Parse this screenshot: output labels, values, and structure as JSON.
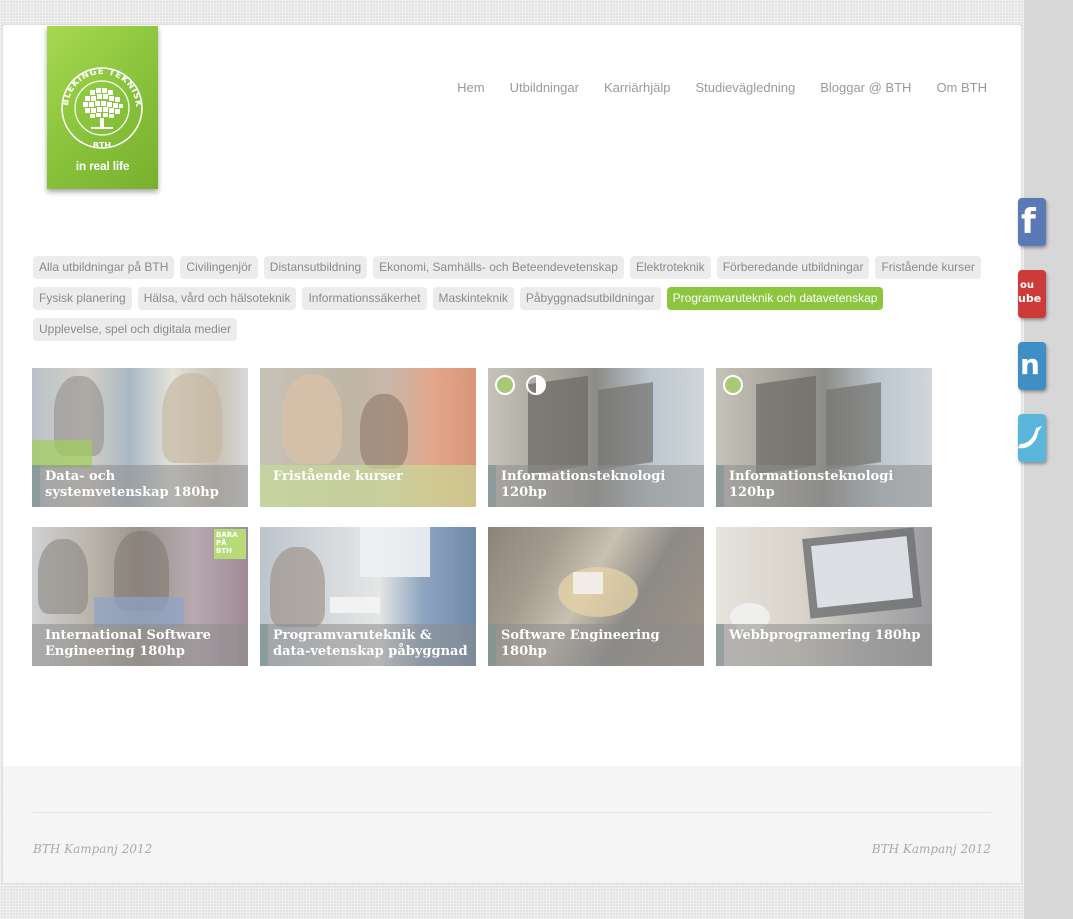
{
  "logo": {
    "ring_text": "BLEKINGE TEKNISKA HÖGSKOLA",
    "abbr": "BTH",
    "tagline": "in real life"
  },
  "nav": [
    "Hem",
    "Utbildningar",
    "Karriärhjälp",
    "Studievägledning",
    "Bloggar @ BTH",
    "Om BTH"
  ],
  "filters": {
    "items": [
      "Alla utbildningar på BTH",
      "Civilingenjör",
      "Distansutbildning",
      "Ekonomi, Samhälls- och Beteendevetenskap",
      "Elektroteknik",
      "Förberedande utbildningar",
      "Fristående kurser",
      "Fysisk planering",
      "Hälsa, vård och hälsoteknik",
      "Informationssäkerhet",
      "Maskinteknik",
      "Påbyggnadsutbildningar",
      "Programvaruteknik och datavetenskap",
      "Upplevelse, spel och digitala medier"
    ],
    "active": "Programvaruteknik och datavetenskap"
  },
  "programs": [
    {
      "title": "Data- och systemvetenskap 180hp"
    },
    {
      "title": "Fristående kurser"
    },
    {
      "title": "Informationsteknologi 120hp"
    },
    {
      "title": "Informationsteknologi 120hp"
    },
    {
      "title": "International Software Engineering 180hp",
      "badge_lines": [
        "BARA",
        "PÅ",
        "BTH"
      ]
    },
    {
      "title": "Programvaruteknik & data-vetenskap påbyggnad"
    },
    {
      "title": "Software Engineering 180hp"
    },
    {
      "title": "Webbprogramering 180hp"
    }
  ],
  "social": [
    "facebook",
    "youtube",
    "linkedin",
    "twitter"
  ],
  "footer": {
    "left": "BTH Kampanj 2012",
    "right": "BTH Kampanj 2012"
  },
  "colors": {
    "accent": "#8cc63f",
    "nav_text": "#9a9a9a",
    "tag_bg": "#ececec"
  }
}
